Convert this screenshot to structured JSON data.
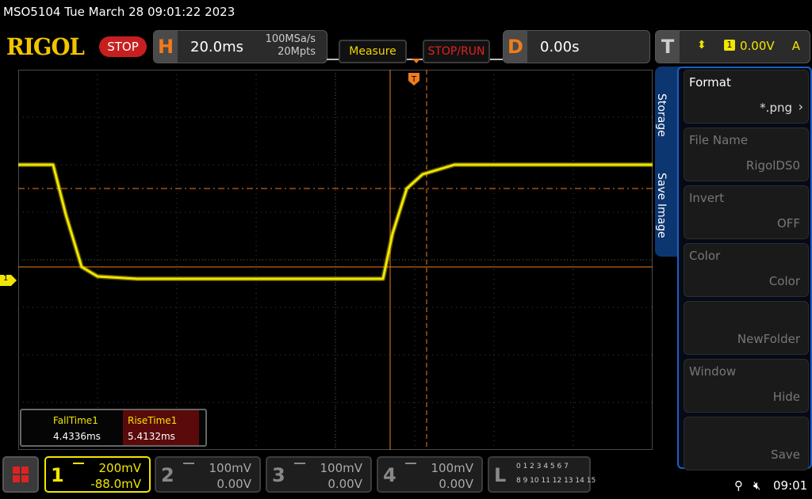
{
  "title": "MSO5104  Tue March 28 09:01:22 2023",
  "logo": "RIGOL",
  "run_state": "STOP",
  "horizontal": {
    "label": "H",
    "timebase": "20.0ms",
    "sample_rate": "100MSa/s",
    "memory_depth": "20Mpts"
  },
  "buttons": {
    "measure": "Measure",
    "stop_run": "STOP/RUN"
  },
  "delay": {
    "label": "D",
    "value": "0.00s"
  },
  "trigger": {
    "label": "T",
    "source_num": "1",
    "level": "0.00V",
    "mode": "A"
  },
  "channel_marker": "1",
  "measurements": [
    {
      "label": "FallTime1",
      "value": "4.4336ms"
    },
    {
      "label": "RiseTime1",
      "value": "5.4132ms"
    }
  ],
  "menu": {
    "tab_top": "Storage",
    "tab_bottom": "Save Image",
    "items": [
      {
        "title": "Format",
        "value": "*.png",
        "enabled": true
      },
      {
        "title": "File Name",
        "value": "RigolDS0",
        "enabled": false
      },
      {
        "title": "Invert",
        "value": "OFF",
        "enabled": false
      },
      {
        "title": "Color",
        "value": "Color",
        "enabled": false
      },
      {
        "title": "",
        "value": "NewFolder",
        "enabled": false
      },
      {
        "title": "Window",
        "value": "Hide",
        "enabled": false
      },
      {
        "title": "",
        "value": "Save",
        "enabled": false
      }
    ]
  },
  "channels": [
    {
      "num": "1",
      "scale": "200mV",
      "offset": "-88.0mV",
      "active": true,
      "color": "#f2e600"
    },
    {
      "num": "2",
      "scale": "100mV",
      "offset": "0.00V",
      "active": false,
      "color": "#888888"
    },
    {
      "num": "3",
      "scale": "100mV",
      "offset": "0.00V",
      "active": false,
      "color": "#888888"
    },
    {
      "num": "4",
      "scale": "100mV",
      "offset": "0.00V",
      "active": false,
      "color": "#888888"
    }
  ],
  "logic": {
    "label": "L",
    "row1": "0 1 2 3  4 5 6 7",
    "row2": "8 9 10 11 12 13 14 15"
  },
  "status_time": "09:01",
  "icons": {
    "usb": "usb-icon",
    "speaker": "speaker-mute-icon"
  },
  "colors": {
    "ch1": "#f2e600",
    "cursor": "#f07c1c",
    "menu_border": "#1b5fc4",
    "stop": "#c71f1f"
  },
  "chart_data": {
    "type": "line",
    "title": "",
    "xlabel": "",
    "ylabel": "",
    "series": [
      {
        "x": [
          0,
          22,
          30,
          40,
          50,
          75,
          180,
          230,
          236,
          245,
          255,
          275,
          400
        ],
        "values": [
          0.43,
          0.43,
          0.22,
          0.0,
          -0.04,
          -0.05,
          -0.05,
          -0.05,
          0.14,
          0.33,
          0.39,
          0.43,
          0.43
        ]
      }
    ],
    "xlim": [
      0,
      400
    ],
    "ylim": [
      -0.77,
      0.83
    ],
    "grid": true
  }
}
